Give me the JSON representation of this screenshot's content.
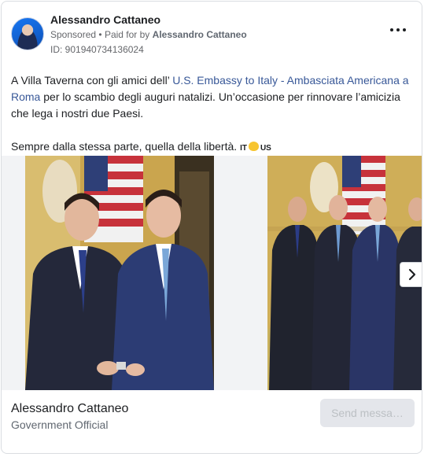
{
  "post": {
    "author": "Alessandro Cattaneo",
    "sponsored": "Sponsored",
    "paid_for_prefix": "Paid for by",
    "paid_for_name": "Alessandro Cattaneo",
    "ad_id": "ID: 901940734136024",
    "text_part1": "A Villa Taverna con gli amici dell’ ",
    "text_link": "U.S. Embassy to Italy - Ambasciata Americana a Roma",
    "text_part2": " per lo scambio degli auguri natalizi. Un’occasione per rinnovare l’amicizia che lega i nostri due Paesi.",
    "text_line2": "Sempre dalla stessa parte, quella della libertà. ",
    "flag_it": "IT",
    "flag_us": "US"
  },
  "footer": {
    "name": "Alessandro Cattaneo",
    "subtitle": "Government Official",
    "send_label": "Send messa…"
  },
  "icons": {
    "more": "more-horizontal-icon",
    "next": "chevron-right-icon",
    "heart": "yellow-heart-emoji"
  },
  "colors": {
    "link": "#385898",
    "meta": "#65676b"
  }
}
